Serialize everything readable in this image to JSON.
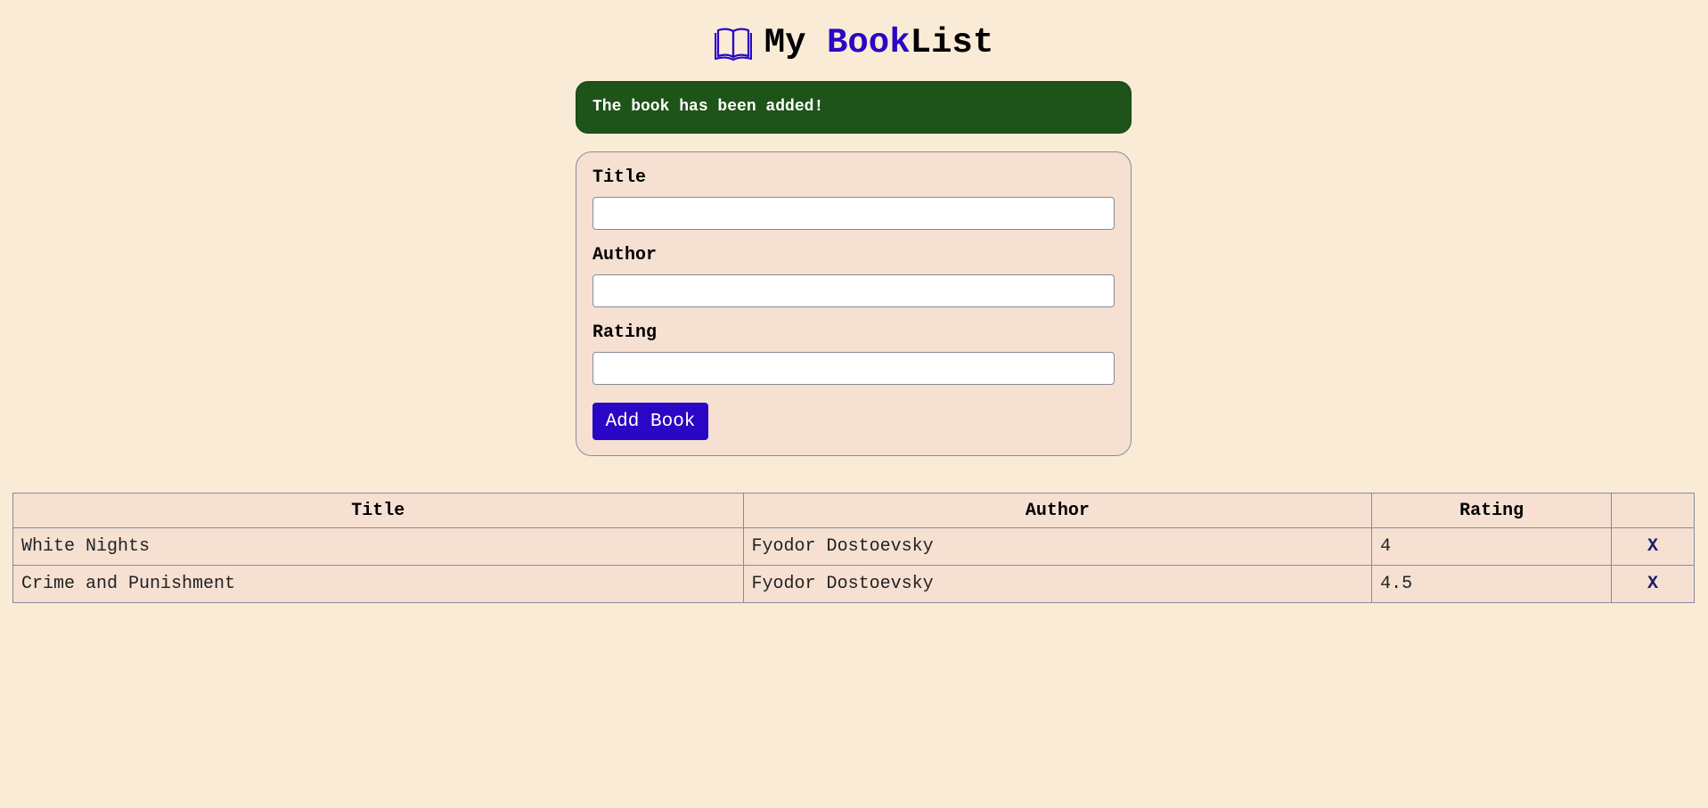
{
  "header": {
    "title_prefix": "My ",
    "title_accent": "Book",
    "title_suffix": "List",
    "icon": "book-open-icon",
    "accent_color": "#2a07c4"
  },
  "alert": {
    "message": "The book has been added!",
    "color": "#1e5319"
  },
  "form": {
    "title_label": "Title",
    "title_value": "",
    "author_label": "Author",
    "author_value": "",
    "rating_label": "Rating",
    "rating_value": "",
    "submit_label": "Add Book"
  },
  "table": {
    "headers": [
      "Title",
      "Author",
      "Rating",
      ""
    ],
    "rows": [
      {
        "title": "White Nights",
        "author": "Fyodor Dostoevsky",
        "rating": "4",
        "delete_label": "X"
      },
      {
        "title": "Crime and Punishment",
        "author": "Fyodor Dostoevsky",
        "rating": "4.5",
        "delete_label": "X"
      }
    ]
  },
  "colors": {
    "background": "#faebd7",
    "card": "#f5e0d2",
    "button": "#2a07c4"
  }
}
